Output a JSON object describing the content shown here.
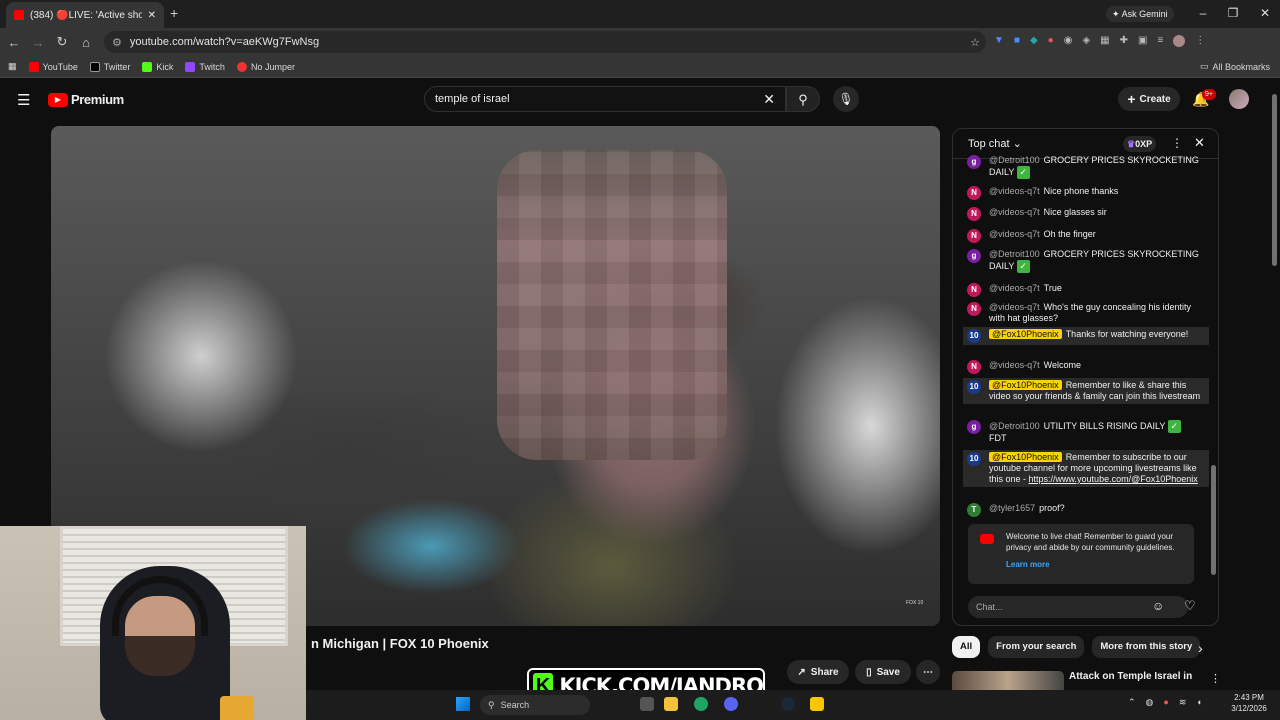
{
  "browser": {
    "tab_title": "(384) 🔴LIVE: 'Active shoo",
    "gemini_label": "Ask Gemini",
    "url": "youtube.com/watch?v=aeKWg7FwNsg",
    "bookmarks": [
      "YouTube",
      "Twitter",
      "Kick",
      "Twitch",
      "No Jumper"
    ],
    "all_bookmarks": "All Bookmarks"
  },
  "youtube": {
    "logo_text": "Premium",
    "search_value": "temple of israel",
    "create_label": "Create",
    "notification_count": "9+"
  },
  "video": {
    "title_visible": "n Michigan | FOX 10 Phoenix",
    "watermark": "FOX 10",
    "share_label": "Share",
    "save_label": "Save"
  },
  "overlay": {
    "kick_text": "KICK.COM/JANDRO"
  },
  "chat": {
    "mode_label": "Top chat",
    "xp_label": "0XP",
    "messages": [
      {
        "author": "@Detroit100",
        "text": "GROCERY PRICES SKYROCKETING DAILY",
        "avatar": "g"
      },
      {
        "author": "@videos-q7t",
        "text": "Nice phone thanks",
        "avatar": "N"
      },
      {
        "author": "@videos-q7t",
        "text": "Nice glasses sir",
        "avatar": "N"
      },
      {
        "author": "@videos-q7t",
        "text": "Oh the finger",
        "avatar": "N"
      },
      {
        "author": "@Detroit100",
        "text": "GROCERY PRICES SKYROCKETING DAILY",
        "avatar": "g"
      },
      {
        "author": "@videos-q7t",
        "text": "True",
        "avatar": "N"
      },
      {
        "author": "@videos-q7t",
        "text": "Who's the guy concealing his identity with hat glasses?",
        "avatar": "N"
      },
      {
        "author": "@Fox10Phoenix",
        "text": "Thanks for watching everyone!",
        "avatar": "10"
      },
      {
        "author": "@videos-q7t",
        "text": "Welcome",
        "avatar": "N"
      },
      {
        "author": "@Fox10Phoenix",
        "text": "Remember to like & share this video so your friends & family can join this livestream",
        "avatar": "10"
      },
      {
        "author": "@Detroit100",
        "text": "UTILITY BILLS RISING DAILY",
        "text2": "FDT",
        "avatar": "g"
      },
      {
        "author": "@Fox10Phoenix",
        "text": "Remember to subscribe to our youtube channel for more upcoming livestreams like this one - ",
        "link": "https://www.youtube.com/@Fox10Phoenix",
        "avatar": "10"
      },
      {
        "author": "@tyler1657",
        "text": "proof?",
        "avatar": "T"
      }
    ],
    "welcome_text": "Welcome to live chat! Remember to guard your privacy and abide by our community guidelines.",
    "learn_more": "Learn more",
    "input_placeholder": "Chat..."
  },
  "chips": [
    "All",
    "From your search",
    "More from this story"
  ],
  "related": {
    "title": "Attack on Temple Israel in"
  },
  "taskbar": {
    "search_label": "Search",
    "time": "2:43 PM",
    "date": "3/12/2026"
  },
  "colors": {
    "youtube_red": "#ff0000",
    "fox_yellow": "#f9d400",
    "kick_green": "#53fc18",
    "link_blue": "#3ea6ff"
  }
}
